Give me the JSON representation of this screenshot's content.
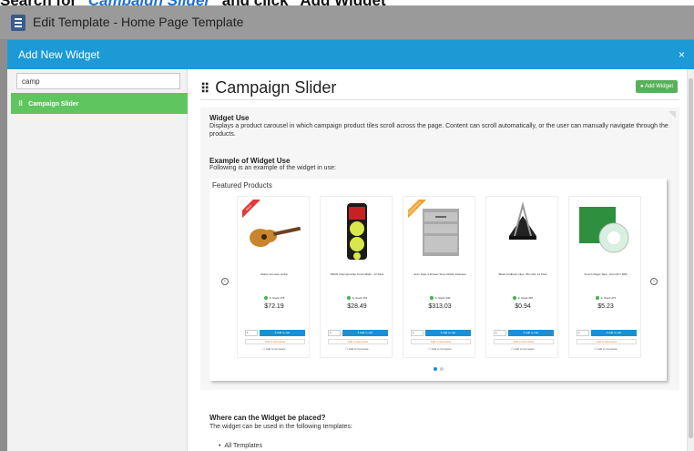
{
  "instruction": {
    "prefix": "Search for ",
    "highlight": "\"Campaign Slider\"",
    "suffix": " and click \"Add Widget\""
  },
  "background": {
    "title": "Edit Template - Home Page Template"
  },
  "modal": {
    "title": "Add New Widget",
    "close": "×"
  },
  "search": {
    "value": "camp"
  },
  "left_list": [
    {
      "label": "Campaign Slider"
    }
  ],
  "widget": {
    "title": "Campaign Slider",
    "add_button": "Add Widget",
    "use_heading": "Widget Use",
    "use_text": "Displays a product carousel in which campaign product tiles scroll across the page. Content can scroll automatically, or the user can manually navigate through the products.",
    "example_heading": "Example of Widget Use",
    "example_text": "Following is an example of the widget in use:",
    "demo_title": "Featured Products",
    "where_heading": "Where can the Widget be placed?",
    "where_text": "The widget can be used in the following templates:",
    "where_items": [
      "All Templates"
    ]
  },
  "products": [
    {
      "name": "Starter Acoustic Guitar",
      "stock": "In Stock 178",
      "price": "$72.19",
      "badge": "SALE",
      "badge_color": "#e03a3a"
    },
    {
      "name": "PENN Championship Tennis Balls - 12 Pack",
      "stock": "In Stock 119",
      "price": "$28.49",
      "badge": "",
      "badge_color": ""
    },
    {
      "name": "Euro Style 3-Drawer Steel Mobile Pedestal",
      "stock": "In Stock 340",
      "price": "$313.03",
      "badge": "CLEARANCE",
      "badge_color": "#f0a030"
    },
    {
      "name": "Black Foldback Clips, 25mmW, 12 Pack",
      "stock": "In Stock 287",
      "price": "$0.94",
      "badge": "",
      "badge_color": ""
    },
    {
      "name": "Scotch Magic Tape, 12mmW x 66M",
      "stock": "In Stock 272",
      "price": "$5.23",
      "badge": "",
      "badge_color": ""
    }
  ],
  "card_labels": {
    "add_to_cart": "Add to cart",
    "favourites": "Add to favourites",
    "compare": "Add to Compare",
    "qty": "1"
  },
  "icons": {
    "grip": "grip-icon",
    "left": "chevron-left-icon",
    "right": "chevron-right-icon",
    "cart": "cart-icon",
    "plus": "plus-circle-icon"
  },
  "colors": {
    "header": "#1b9ad6",
    "selected": "#5fc65f",
    "add_button": "#5ab05a",
    "cart_button": "#1a8fd6"
  }
}
